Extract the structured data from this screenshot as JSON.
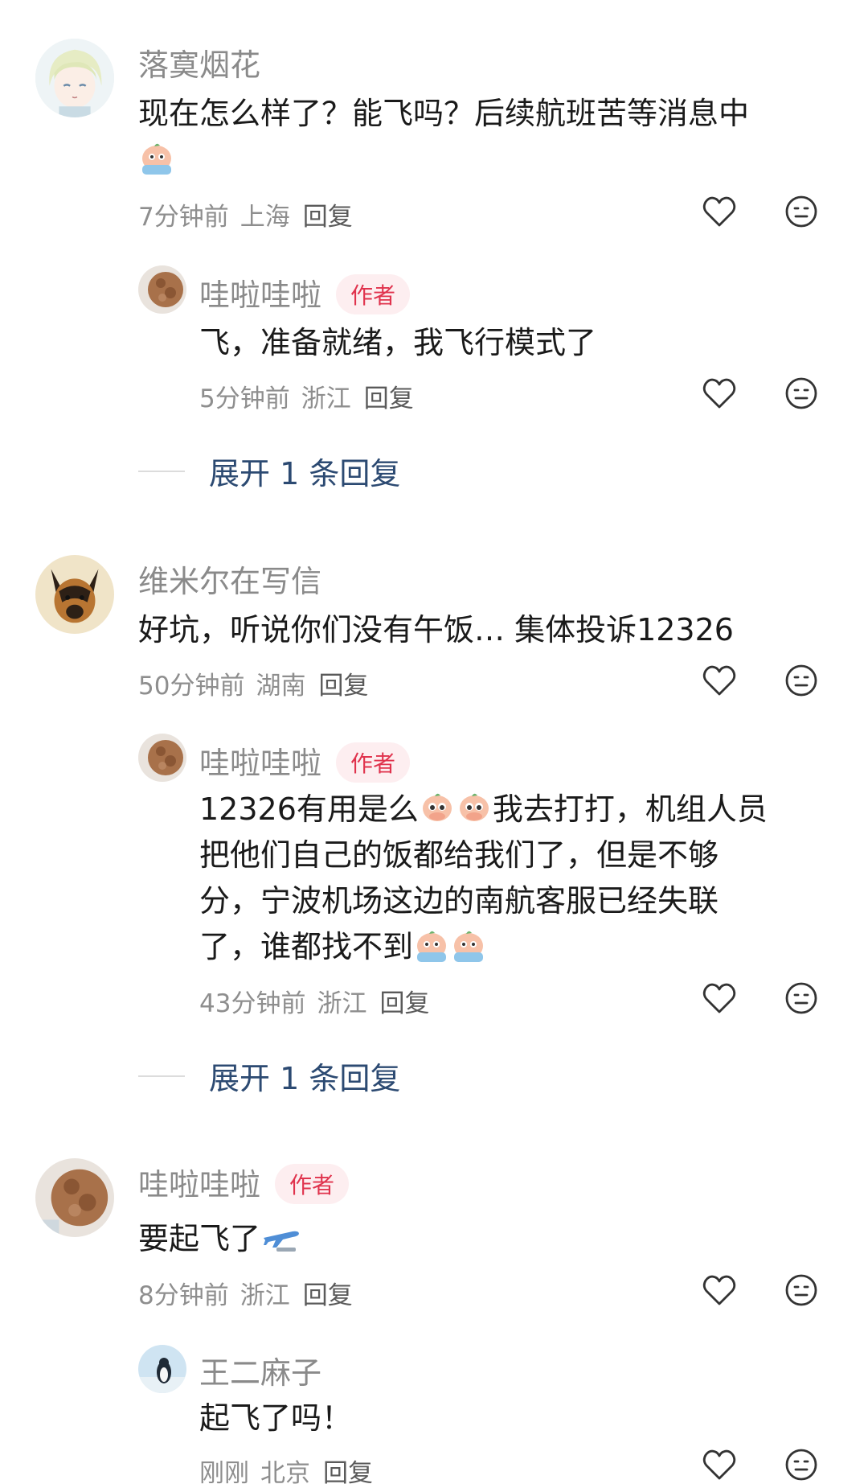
{
  "comments": [
    {
      "user": "落寞烟花",
      "text_line1": "现在怎么样了？能飞吗？后续航班苦等消息中",
      "time": "7分钟前",
      "location": "上海",
      "reply_label": "回复",
      "avatar_icon": "anime-avatar-icon",
      "replies": [
        {
          "user": "哇啦哇啦",
          "badge": "作者",
          "text": "飞，准备就绪，我飞行模式了",
          "time": "5分钟前",
          "location": "浙江",
          "reply_label": "回复"
        }
      ],
      "expand_label": "展开 1 条回复"
    },
    {
      "user": "维米尔在写信",
      "text_line1": "好坑，听说你们没有午饭… 集体投诉12326",
      "time": "50分钟前",
      "location": "湖南",
      "reply_label": "回复",
      "avatar_icon": "dog-avatar-icon",
      "replies": [
        {
          "user": "哇啦哇啦",
          "badge": "作者",
          "text_part1": "12326有用是么",
          "text_part2": "我去打打，机组人员",
          "text_line2": "把他们自己的饭都给我们了，但是不够",
          "text_line3": "分，宁波机场这边的南航客服已经失联",
          "text_line4": "了，谁都找不到",
          "time": "43分钟前",
          "location": "浙江",
          "reply_label": "回复"
        }
      ],
      "expand_label": "展开 1 条回复"
    },
    {
      "user": "哇啦哇啦",
      "badge": "作者",
      "text_line1": "要起飞了",
      "time": "8分钟前",
      "location": "浙江",
      "reply_label": "回复",
      "avatar_icon": "teddy-bear-avatar-icon",
      "replies": [
        {
          "user": "王二麻子",
          "text": "起飞了吗！",
          "time": "刚刚",
          "location": "北京",
          "reply_label": "回复"
        }
      ]
    }
  ],
  "colors": {
    "badge_bg": "#fdeef0",
    "badge_text": "#e0334d",
    "expand_text": "#2c4a72",
    "meta_text": "#8e8e8e"
  }
}
